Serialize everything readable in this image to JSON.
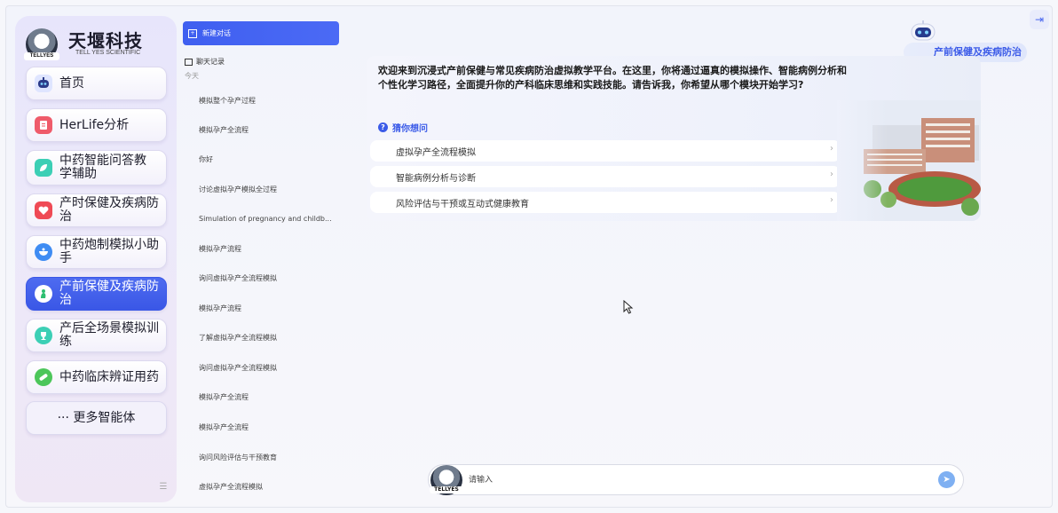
{
  "brand": {
    "name": "天堰科技",
    "subtitle": "TELL YES SCIENTIFIC",
    "logo_tag": "TELLYES"
  },
  "sidebar": {
    "items": [
      {
        "label": "首页",
        "icon": "robot-icon",
        "color": "#5a7af0"
      },
      {
        "label": "HerLife分析",
        "icon": "document-icon",
        "color": "#ef5b6a"
      },
      {
        "label": "中药智能问答教学辅助",
        "icon": "leaf-chat-icon",
        "color": "#3ccfb5"
      },
      {
        "label": "产时保健及疾病防治",
        "icon": "heart-icon",
        "color": "#ef4a55"
      },
      {
        "label": "中药炮制模拟小助手",
        "icon": "herb-bowl-icon",
        "color": "#3f8cf3"
      },
      {
        "label": "产前保健及疾病防治",
        "icon": "mother-icon",
        "color": "#2fbf71",
        "active": true
      },
      {
        "label": "产后全场景模拟训练",
        "icon": "trophy-icon",
        "color": "#3ccfb5"
      },
      {
        "label": "中药临床辨证用药",
        "icon": "pill-icon",
        "color": "#4cc65a"
      }
    ],
    "more_label": "···   更多智能体"
  },
  "history": {
    "new_chat_label": "新建对话",
    "title": "聊天记录",
    "today_label": "今天",
    "items": [
      "模拟整个孕产过程",
      "模拟孕产全流程",
      "你好",
      "讨论虚拟孕产模拟全过程",
      "Simulation of pregnancy and childb...",
      "模拟孕产流程",
      "询问虚拟孕产全流程模拟",
      "模拟孕产流程",
      "了解虚拟孕产全流程模拟",
      "询问虚拟孕产全流程模拟",
      "模拟孕产全流程",
      "模拟孕产全流程",
      "询问风险评估与干预教育",
      "虚拟孕产全流程模拟"
    ]
  },
  "main": {
    "welcome": "欢迎来到沉浸式产前保健与常见疾病防治虚拟教学平台。在这里，你将通过逼真的模拟操作、智能病例分析和个性化学习路径，全面提升你的产科临床思维和实践技能。请告诉我，你希望从哪个模块开始学习?",
    "guess_label": "猜你想问",
    "suggestions": [
      "虚拟孕产全流程模拟",
      "智能病例分析与诊断",
      "风险评估与干预或互动式健康教育"
    ]
  },
  "header": {
    "agent_name": "产前保健及疾病防治"
  },
  "input": {
    "placeholder": "请输入"
  },
  "colors": {
    "accent": "#3f5ff0",
    "active_nav": "#3a57e6"
  }
}
